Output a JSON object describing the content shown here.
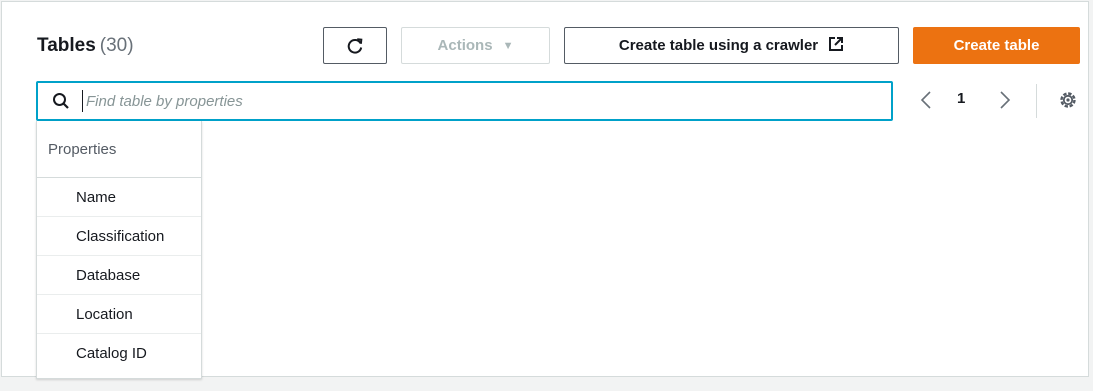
{
  "header": {
    "title": "Tables",
    "count": "(30)"
  },
  "toolbar": {
    "refresh_icon": "refresh-icon",
    "actions_label": "Actions",
    "actions_caret": "▼",
    "crawler_label": "Create table using a crawler",
    "crawler_icon": "external-link-icon",
    "create_label": "Create table"
  },
  "search": {
    "placeholder": "Find table by properties",
    "value": ""
  },
  "pagination": {
    "current_page": "1"
  },
  "dropdown": {
    "header": "Properties",
    "items": [
      {
        "label": "Name"
      },
      {
        "label": "Classification"
      },
      {
        "label": "Database"
      },
      {
        "label": "Location"
      },
      {
        "label": "Catalog ID"
      }
    ]
  },
  "colors": {
    "primary": "#ec7211",
    "focus": "#00a1c9",
    "text": "#16191f",
    "muted": "#687078"
  }
}
